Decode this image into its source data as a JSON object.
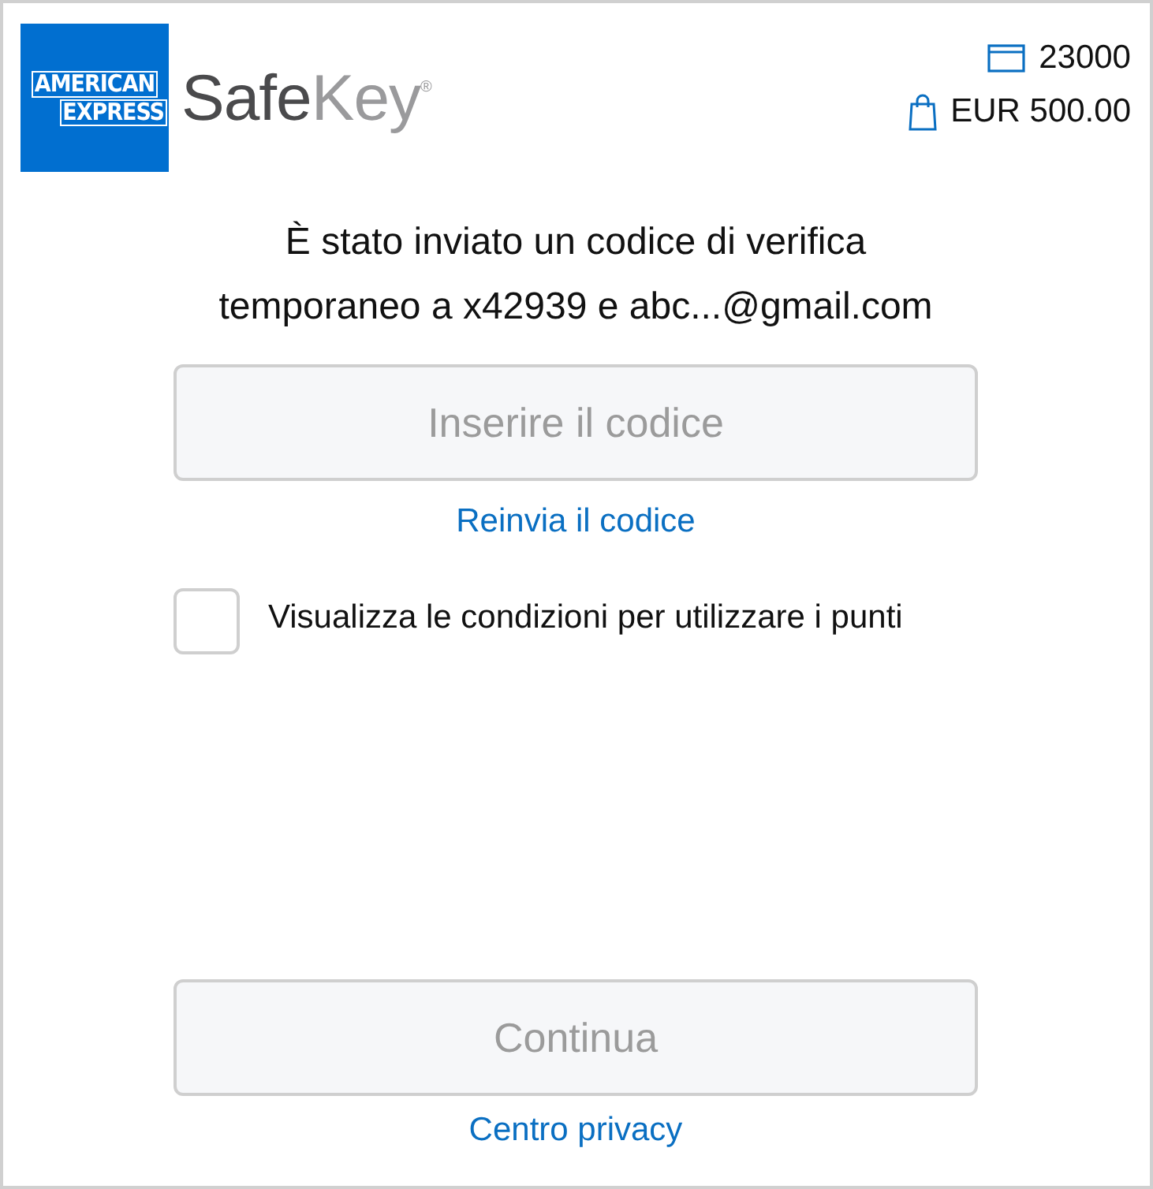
{
  "logo": {
    "badge_lines": [
      "AMERICAN",
      "EXPRESS"
    ],
    "product_first": "Safe",
    "product_second": "Key",
    "registered_mark": "®"
  },
  "summary": {
    "card": "23000",
    "amount": "EUR 500.00"
  },
  "message": "È stato inviato un codice di verifica temporaneo a x42939 e abc...@gmail.com",
  "code_field": {
    "placeholder": "Inserire il codice"
  },
  "resend_link": "Reinvia il codice",
  "terms": {
    "label": "Visualizza le condizioni per utilizzare i punti",
    "checked": false
  },
  "continue_button": {
    "label": "Continua",
    "disabled": true
  },
  "privacy_link": "Centro privacy"
}
